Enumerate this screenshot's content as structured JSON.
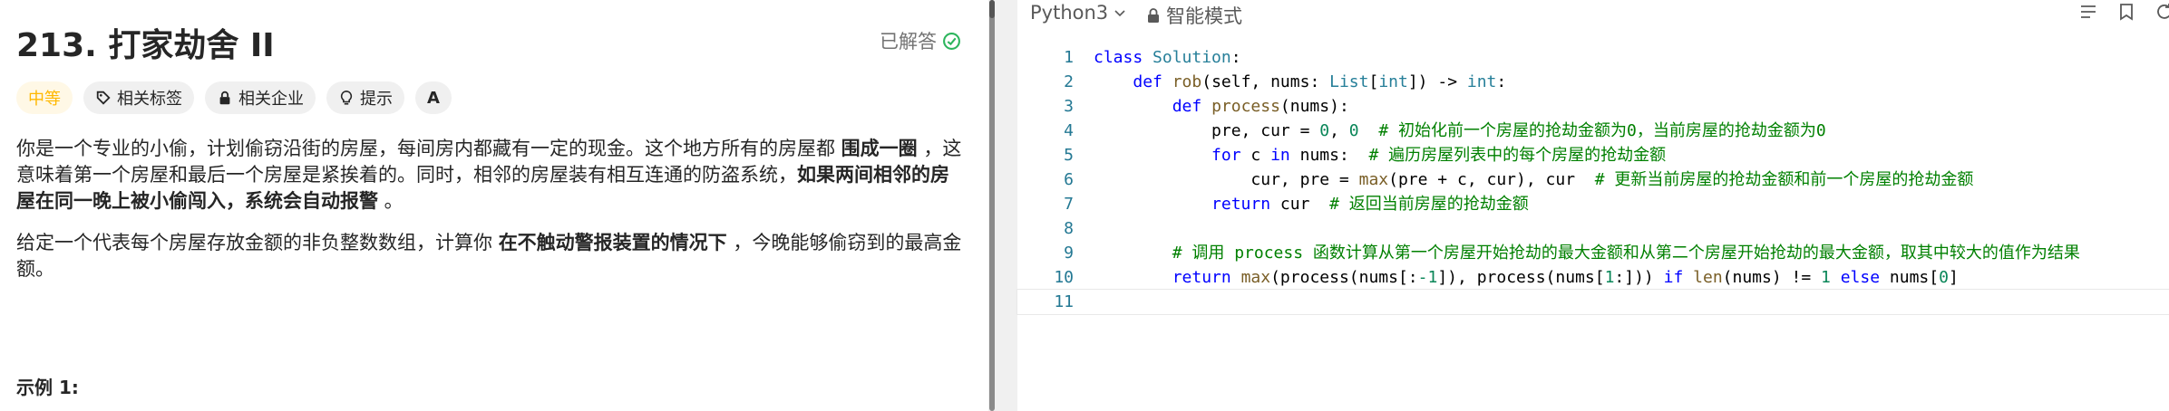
{
  "problem": {
    "title": "213. 打家劫舍 II",
    "solved_label": "已解答",
    "tags": {
      "difficulty": "中等",
      "related_tags": "相关标签",
      "related_companies": "相关企业",
      "hint": "提示",
      "translate": "A"
    },
    "p1_a": "你是一个专业的小偷，计划偷窃沿街的房屋，每间房内都藏有一定的现金。这个地方所有的房屋都 ",
    "p1_b": "围成一圈",
    "p1_c": " ，这意味着第一个房屋和最后一个房屋是紧挨着的。同时，相邻的房屋装有相互连通的防盗系统，",
    "p1_d": "如果两间相邻的房屋在同一晚上被小偷闯入，系统会自动报警",
    "p1_e": " 。",
    "p2_a": "给定一个代表每个房屋存放金额的非负整数数组，计算你 ",
    "p2_b": "在不触动警报装置的情况下",
    "p2_c": " ，今晚能够偷窃到的最高金额。",
    "example_heading": "示例 1:"
  },
  "editor": {
    "language": "Python3",
    "mode": "智能模式",
    "line_numbers": [
      "1",
      "2",
      "3",
      "4",
      "5",
      "6",
      "7",
      "8",
      "9",
      "10",
      "11"
    ],
    "code": {
      "l1_kw": "class",
      "l1_name": "Solution",
      "l1_end": ":",
      "l2_kw": "def",
      "l2_fn": "rob",
      "l2_a": "(self, nums: ",
      "l2_ty": "List",
      "l2_b": "[",
      "l2_int": "int",
      "l2_c": "]) -> ",
      "l2_int2": "int",
      "l2_d": ":",
      "l3_kw": "def",
      "l3_fn": "process",
      "l3_a": "(nums):",
      "l4_a": "pre, cur = ",
      "l4_n1": "0",
      "l4_b": ", ",
      "l4_n2": "0",
      "l4_cm": "  # 初始化前一个房屋的抢劫金额为0，当前房屋的抢劫金额为0",
      "l5_kw": "for",
      "l5_a": " c ",
      "l5_kw2": "in",
      "l5_b": " nums:",
      "l5_cm": "  # 遍历房屋列表中的每个房屋的抢劫金额",
      "l6_a": "cur, pre = ",
      "l6_bi": "max",
      "l6_b": "(pre + c, cur), cur",
      "l6_cm": "  # 更新当前房屋的抢劫金额和前一个房屋的抢劫金额",
      "l7_kw": "return",
      "l7_a": " cur",
      "l7_cm": "  # 返回当前房屋的抢劫金额",
      "l9_cm": "# 调用 process 函数计算从第一个房屋开始抢劫的最大金额和从第二个房屋开始抢劫的最大金额，取其中较大的值作为结果",
      "l10_kw": "return",
      "l10_a": " ",
      "l10_bi": "max",
      "l10_b": "(process(nums[:",
      "l10_n1": "-1",
      "l10_c": "]), process(nums[",
      "l10_n2": "1",
      "l10_d": ":])) ",
      "l10_kw2": "if",
      "l10_e": " ",
      "l10_bi2": "len",
      "l10_f": "(nums) != ",
      "l10_n3": "1",
      "l10_g": " ",
      "l10_kw3": "else",
      "l10_h": " nums[",
      "l10_n4": "0",
      "l10_i": "]"
    }
  },
  "colors": {
    "difficulty": "#ffb800",
    "solved_check": "#2db55d",
    "keyword": "#0000ff",
    "comment": "#008000"
  },
  "icons": [
    "check-circle-icon",
    "tag-icon",
    "lock-icon",
    "lightbulb-icon",
    "translate-icon",
    "chevron-down-icon",
    "lock-icon",
    "list-icon",
    "bookmark-icon",
    "reset-icon"
  ]
}
